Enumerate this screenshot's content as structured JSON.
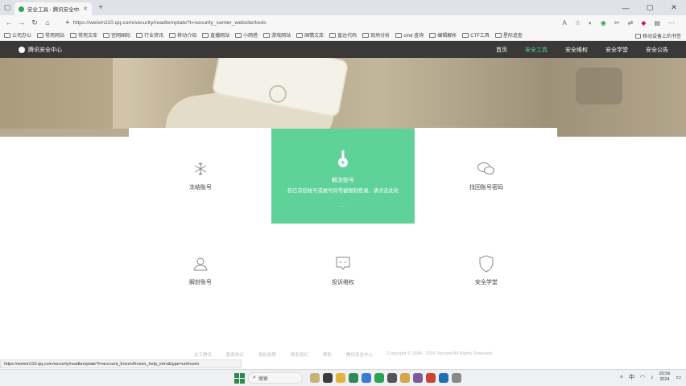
{
  "browser": {
    "tab_title": "安全工具 - 腾讯安全中心 - 守",
    "url": "https://weixin110.qq.com/security/readtemplate?t=security_center_website/tools",
    "status_url": "https://weixin110.qq.com/security/readtemplate?t=account_frozen/frozen_help_intro&type=unfrozen"
  },
  "bookmarks": [
    "公司办公",
    "常用网站",
    "常用文库",
    "宫网国际",
    "行业资讯",
    "移动介绍",
    "直播网站",
    "小网搭",
    "游戏网站",
    "国情文库",
    "直达代码",
    "现场分析",
    "cmd 查询",
    "编辑解析",
    "CTF工具",
    "星际追查"
  ],
  "bookmarks_right": "移动设备上的书签",
  "site": {
    "brand": "腾讯安全中心",
    "nav": [
      "首页",
      "安全工具",
      "安全维权",
      "安全学堂",
      "安全公告"
    ],
    "active_nav": "安全工具"
  },
  "tools": [
    {
      "label": "冻结账号",
      "icon": "snowflake-icon"
    },
    {
      "label": "解冻账号",
      "icon": "key-icon",
      "desc": "若已冻结帐号或帐号异常被限制登录，请点击此处",
      "more": "..."
    },
    {
      "label": "找回账号密码",
      "icon": "chat-bubbles-icon"
    },
    {
      "label": "解封账号",
      "icon": "user-icon"
    },
    {
      "label": "投诉维权",
      "icon": "message-icon"
    },
    {
      "label": "安全学堂",
      "icon": "shield-icon"
    }
  ],
  "footer": [
    "关于腾讯",
    "服务协议",
    "隐私政策",
    "联系我们",
    "帮助",
    "腾讯安全中心",
    "Copyright © 1998 - 2024 Tencent All Rights Reserved"
  ],
  "taskbar": {
    "search_placeholder": "搜索",
    "time": "20:56",
    "date": "2024"
  },
  "colors": {
    "accent": "#5fd29a",
    "header": "#3a3937"
  }
}
